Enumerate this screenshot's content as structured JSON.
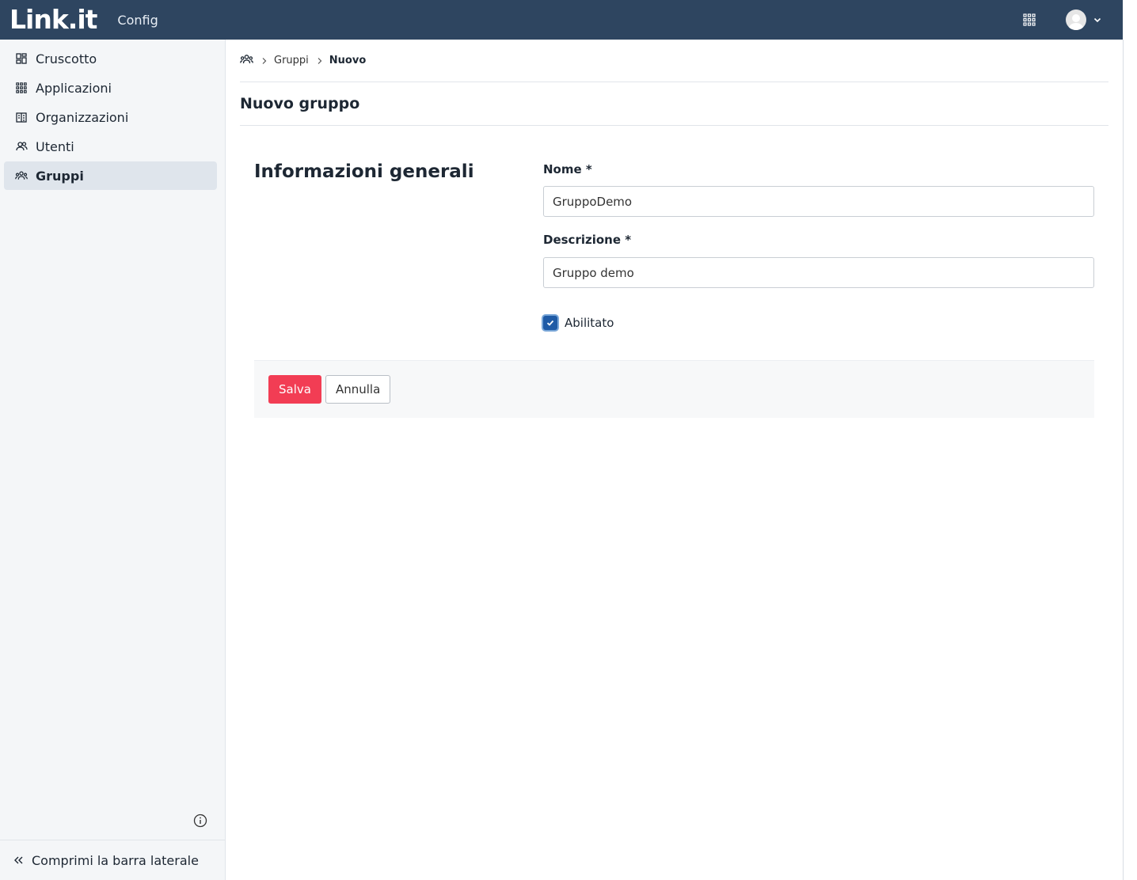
{
  "header": {
    "logo_text": "Link.it",
    "app_name": "Config",
    "apps_icon": "apps-grid-icon",
    "avatar_icon": "user-avatar-icon"
  },
  "sidebar": {
    "items": [
      {
        "label": "Cruscotto",
        "icon": "dashboard-icon",
        "active": false
      },
      {
        "label": "Applicazioni",
        "icon": "apps-grid-icon",
        "active": false
      },
      {
        "label": "Organizzazioni",
        "icon": "building-icon",
        "active": false
      },
      {
        "label": "Utenti",
        "icon": "users-icon",
        "active": false
      },
      {
        "label": "Gruppi",
        "icon": "groups-icon",
        "active": true
      }
    ],
    "collapse_label": "Comprimi la barra laterale"
  },
  "breadcrumb": {
    "items": [
      "Gruppi",
      "Nuovo"
    ]
  },
  "page": {
    "title": "Nuovo gruppo"
  },
  "form": {
    "section_title": "Informazioni generali",
    "name": {
      "label": "Nome *",
      "value": "GruppoDemo"
    },
    "description": {
      "label": "Descrizione *",
      "value": "Gruppo demo"
    },
    "enabled": {
      "label": "Abilitato",
      "checked": true
    }
  },
  "actions": {
    "save_label": "Salva",
    "cancel_label": "Annulla"
  },
  "colors": {
    "topbar": "#2e4560",
    "primary_button": "#f23d54",
    "checkbox": "#1f5ba6",
    "sidebar_bg": "#f4f6f8",
    "active_item_bg": "#dfe5ec"
  }
}
